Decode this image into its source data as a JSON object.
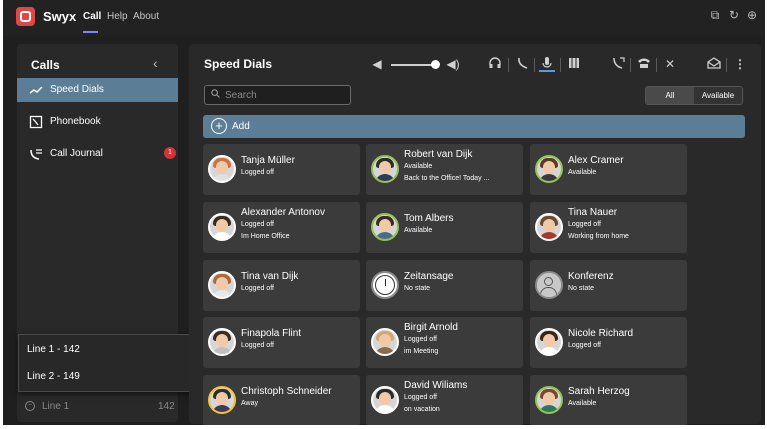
{
  "topbar": {
    "brand": "Swyx",
    "nav": [
      {
        "label": "Call"
      },
      {
        "label": "Help"
      },
      {
        "label": "About"
      }
    ],
    "icons": [
      "popout-icon",
      "refresh-icon",
      "globe-icon"
    ]
  },
  "sidebar": {
    "title": "Calls",
    "collapse_icon": "chevron-left-icon",
    "items": [
      {
        "label": "Speed Dials",
        "icon": "speed-dial-icon",
        "selected": true
      },
      {
        "label": "Phonebook",
        "icon": "phonebook-icon"
      },
      {
        "label": "Call Journal",
        "icon": "call-journal-icon",
        "badge": "1"
      }
    ],
    "line_popup": [
      "Line 1 - 142",
      "Line 2 - 149"
    ],
    "current_line": {
      "label": "Line 1",
      "number": "142"
    }
  },
  "main": {
    "title": "Speed Dials",
    "search_placeholder": "Search",
    "filter": {
      "options": [
        "All",
        "Available"
      ],
      "selected": "All"
    },
    "add_label": "Add",
    "toolbar_icons": [
      "volume-down-icon",
      "volume-slider",
      "volume-up-icon",
      "headset-icon",
      "handset-icon",
      "microphone-icon",
      "conference-icon",
      "call-forward-icon",
      "phone-icon",
      "dnd-icon",
      "voicemail-icon",
      "more-icon"
    ],
    "volume": 0.95
  },
  "contacts": [
    {
      "name": "Tanja Müller",
      "status": "Logged off",
      "note": "",
      "ring": "off",
      "hair": "#c9753d",
      "shirt": "#e0e0e0"
    },
    {
      "name": "Robert van Dijk",
      "status": "Available",
      "note": "Back to the Office! Today ...",
      "ring": "available",
      "hair": "#2b2b2b",
      "shirt": "#2d3b55"
    },
    {
      "name": "Alex Cramer",
      "status": "Available",
      "note": "",
      "ring": "available",
      "hair": "#5a3a22",
      "shirt": "#3a3a3a"
    },
    {
      "name": "Alexander Antonov",
      "status": "Logged off",
      "note": "Im Home Office",
      "ring": "off",
      "hair": "#3a2a1a",
      "shirt": "#ffffff"
    },
    {
      "name": "Tom Albers",
      "status": "Available",
      "note": "",
      "ring": "available",
      "hair": "#3d2b1f",
      "shirt": "#4b6b8a"
    },
    {
      "name": "Tina Nauer",
      "status": "Logged off",
      "note": "Working from home",
      "ring": "off",
      "hair": "#6b4a2e",
      "shirt": "#a23b2b"
    },
    {
      "name": "Tina van Dijk",
      "status": "Logged off",
      "note": "",
      "ring": "off",
      "hair": "#b0683a",
      "shirt": "#e8e8e8"
    },
    {
      "name": "Zeitansage",
      "status": "No state",
      "note": "",
      "ring": "none",
      "avatar": "clock"
    },
    {
      "name": "Konferenz",
      "status": "No state",
      "note": "",
      "ring": "none",
      "avatar": "generic"
    },
    {
      "name": "Finapola Flint",
      "status": "Logged off",
      "note": "",
      "ring": "off",
      "hair": "#3a2a20",
      "shirt": "#c0c0c0"
    },
    {
      "name": "Birgit Arnold",
      "status": "Logged off",
      "note": "im Meeting",
      "ring": "off",
      "hair": "#d0a870",
      "shirt": "#8a6a50"
    },
    {
      "name": "Nicole Richard",
      "status": "Logged off",
      "note": "",
      "ring": "off",
      "hair": "#3a2418",
      "shirt": "#ffffff"
    },
    {
      "name": "Christoph Schneider",
      "status": "Away",
      "note": "",
      "ring": "away",
      "hair": "#2d2d2d",
      "shirt": "#3b3b5a"
    },
    {
      "name": "David Wiliams",
      "status": "Logged off",
      "note": "on vacation",
      "ring": "off",
      "hair": "#2a2a2a",
      "shirt": "#ffffff"
    },
    {
      "name": "Sarah Herzog",
      "status": "Available",
      "note": "",
      "ring": "available",
      "hair": "#7a4a2a",
      "shirt": "#2a7a5a"
    }
  ]
}
